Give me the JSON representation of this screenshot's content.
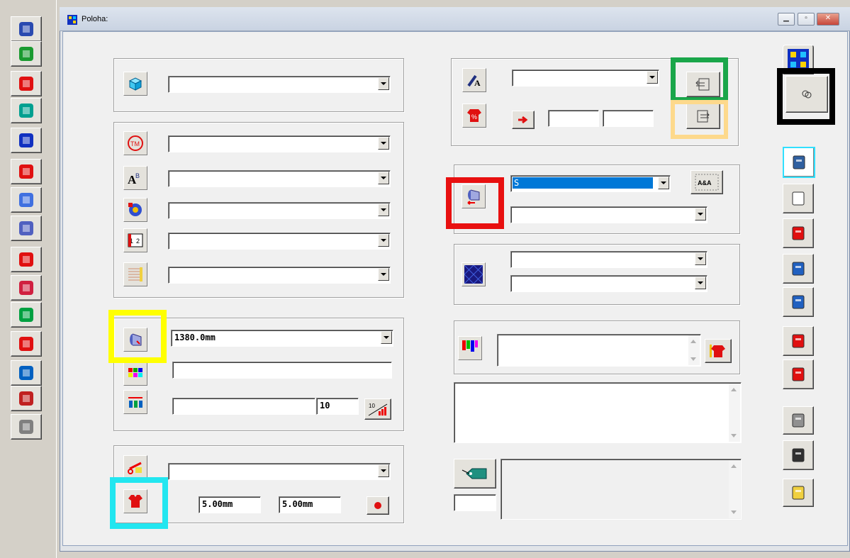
{
  "window": {
    "title": "Poloha:",
    "controls": [
      "minimize",
      "maximize",
      "close"
    ]
  },
  "left_toolbar": {
    "icons": [
      "refresh-icon",
      "chart-icon",
      "garment-red-icon",
      "dress-icon",
      "pattern-grid-icon",
      "pattern-red-icon",
      "color-circles-icon",
      "fabric-roll-icon",
      "arrows-icon",
      "document-hourglass-icon",
      "scissors-cc-icon",
      "cut-pieces-icon",
      "grid-arrows-icon",
      "piece-grid-icon",
      "globe-garment-icon"
    ]
  },
  "left_column": {
    "top_panel": {
      "icon": "cube-icon",
      "combo_value": ""
    },
    "attributes_panel": {
      "rows": [
        {
          "icon": "tm-icon",
          "value": ""
        },
        {
          "icon": "abc-icon",
          "value": ""
        },
        {
          "icon": "color-settings-icon",
          "value": ""
        },
        {
          "icon": "book-1-2-icon",
          "value": ""
        },
        {
          "icon": "fabric-stripes-icon",
          "value": ""
        }
      ]
    },
    "width_panel": {
      "width_value": "1380.0mm",
      "text_value": "",
      "count_value": "",
      "step_value": "10",
      "step_button_label": "10"
    },
    "margins_panel": {
      "combo_value": "",
      "margin_left": "5.00mm",
      "margin_right": "5.00mm"
    }
  },
  "right_column": {
    "top_panel": {
      "combo_value": "",
      "field_a": "",
      "field_b": ""
    },
    "size_panel": {
      "size_value": "S",
      "second_value": "",
      "aba_label": "A&A"
    },
    "pattern_panel": {
      "combo1": "",
      "combo2": ""
    },
    "color_panel": {
      "text": ""
    },
    "notes_panel": {
      "text": ""
    },
    "tag_panel": {
      "small_value": "",
      "text": ""
    }
  },
  "highlights": {
    "green": "#1aa64a",
    "yellow_light": "#fdd98c",
    "black": "#000000",
    "red": "#e81010",
    "yellow": "#ffff00",
    "cyan": "#22e6f0"
  },
  "right_toolbar": {
    "icons": [
      "pattern-tab-icon",
      "coin-icon",
      "cabinet-icon",
      "new-document-icon",
      "markers-icon",
      "layout-print-icon",
      "arrows-colors-icon",
      "color-drop-icon",
      "scissors-sign-icon",
      "printer-icon",
      "save-icon",
      "open-folder-icon"
    ]
  }
}
